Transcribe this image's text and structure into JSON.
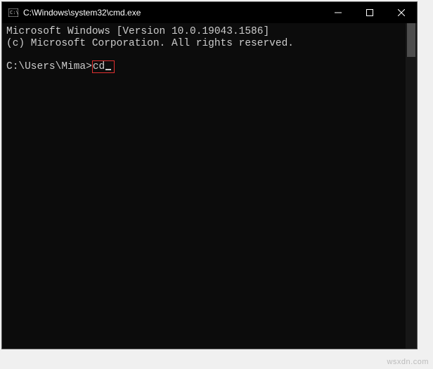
{
  "window": {
    "title": "C:\\Windows\\system32\\cmd.exe"
  },
  "terminal": {
    "line1": "Microsoft Windows [Version 10.0.19043.1586]",
    "line2": "(c) Microsoft Corporation. All rights reserved.",
    "prompt": "C:\\Users\\Mima>",
    "command": "cd"
  },
  "watermark": "wsxdn.com"
}
